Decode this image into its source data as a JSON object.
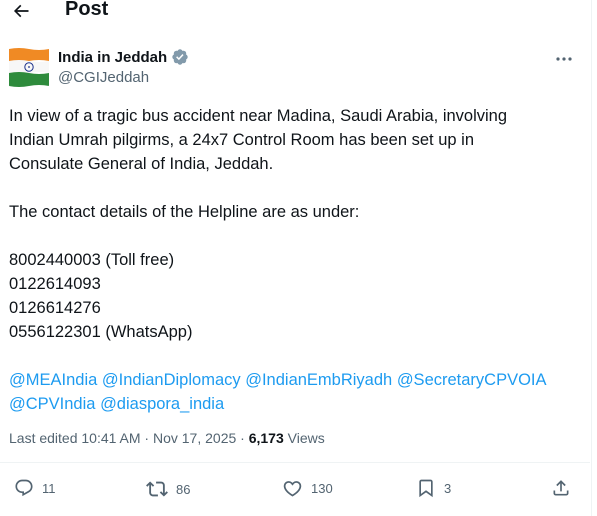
{
  "header": {
    "back_icon": "arrow-left-icon",
    "title": "Post"
  },
  "author": {
    "name": "India in Jeddah",
    "handle": "@CGIJeddah",
    "verified_icon": "verified-badge-icon",
    "avatar": "indian-flag-avatar",
    "more_icon": "more-horizontal-icon"
  },
  "post": {
    "lines_p1": [
      "In view of a tragic bus accident near Madina, Saudi Arabia, involving",
      "Indian Umrah pilgirms, a 24x7 Control Room has been set up in",
      "Consulate General of India, Jeddah."
    ],
    "line_p2": "The contact details of the Helpline are as under:",
    "contacts": [
      "8002440003 (Toll free)",
      "0122614093",
      "0126614276",
      "0556122301 (WhatsApp)"
    ],
    "mentions_line1": [
      "@MEAIndia",
      "@IndianDiplomacy",
      "@IndianEmbRiyadh",
      "@SecretaryCPVOIA"
    ],
    "mentions_line2": [
      "@CPVIndia",
      "@diaspora_india"
    ]
  },
  "meta": {
    "edited": "Last edited 10:41 AM · Nov 17, 2025 · ",
    "views_count": "6,173",
    "views_label": " Views"
  },
  "actions": {
    "replies": "11",
    "reposts": "86",
    "likes": "130",
    "bookmarks": "3"
  },
  "colors": {
    "text": "#0f1419",
    "secondary": "#536471",
    "link": "#1d9bf0",
    "verified": "#829aab",
    "border": "#eff3f4"
  }
}
